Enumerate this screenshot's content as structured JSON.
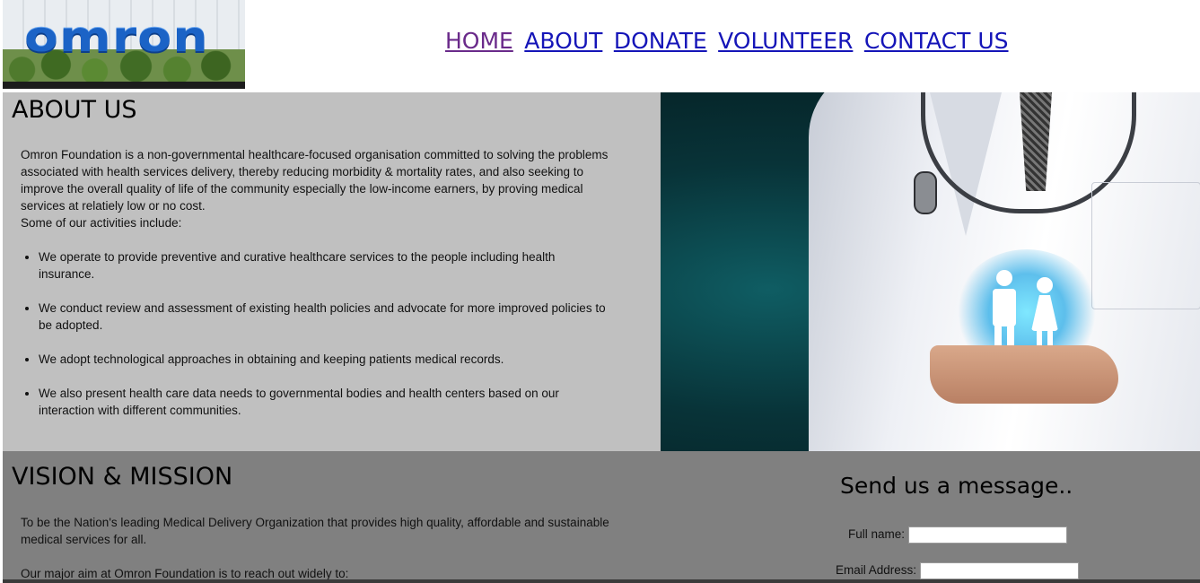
{
  "header": {
    "logo_text": "omron",
    "nav": [
      {
        "label": "HOME"
      },
      {
        "label": "ABOUT"
      },
      {
        "label": "DONATE"
      },
      {
        "label": "VOLUNTEER"
      },
      {
        "label": "CONTACT US"
      }
    ]
  },
  "about": {
    "heading": "ABOUT US",
    "paragraph_lines": [
      "Omron Foundation is a non-governmental healthcare-focused organisation committed to solving the problems",
      "associated with health services delivery, thereby reducing morbidity & mortality rates, and also seeking to",
      "improve the overall quality of life of the community especially the low-income earners, by proving medical",
      "services at relatiely low or no cost."
    ],
    "activities_intro": "Some of our activities include:",
    "activities": [
      {
        "line1": "We operate to provide preventive and curative healthcare services to the people including health",
        "line2": "insurance."
      },
      {
        "line1": "We conduct review and assessment of existing health policies and advocate for more improved policies to",
        "line2": "be adopted."
      },
      {
        "line1": "We adopt technological approaches in obtaining and keeping patients medical records.",
        "line2": ""
      },
      {
        "line1": "We also present health care data needs to governmental bodies and health centers based on our",
        "line2": "interaction with different communities."
      }
    ]
  },
  "vision": {
    "heading": "VISION & MISSION",
    "paragraph_lines": [
      "To be the Nation's leading Medical Delivery Organization that provides high quality, affordable and sustainable",
      "medical services for all."
    ],
    "aim": "Our major aim at Omron Foundation is to reach out widely to:"
  },
  "contact_form": {
    "title": "Send us a message..",
    "full_name_label": "Full name:",
    "full_name_value": "",
    "email_label": "Email Address:",
    "email_value": ""
  },
  "colors": {
    "about_bg": "#c0c0c0",
    "vision_bg": "#808080",
    "link": "#1515b8",
    "visited_link": "#6a2a8a"
  }
}
